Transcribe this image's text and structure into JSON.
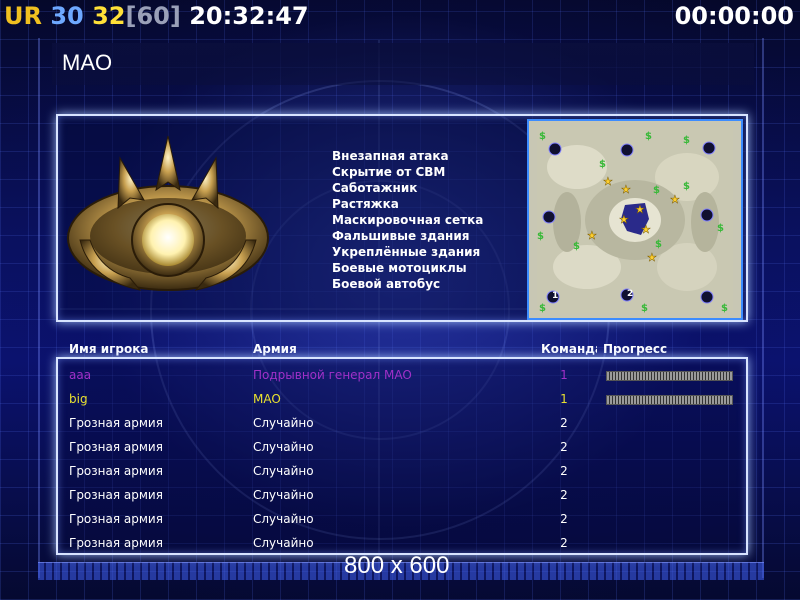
{
  "hud": {
    "ur": "UR",
    "ur_value": "30",
    "fps": "32",
    "fps_limit": "[60]",
    "clock": "20:32:47",
    "timer": "00:00:00"
  },
  "title": "MAO",
  "features": [
    "Внезапная атака",
    "Скрытие от СВМ",
    "Саботажник",
    "Растяжка",
    "Маскировочная сетка",
    "Фальшивые здания",
    "Укреплённые здания",
    "Боевые мотоциклы",
    "Боевой автобус"
  ],
  "minimap": {
    "player_markers": [
      "1",
      "2"
    ]
  },
  "table": {
    "headers": {
      "name": "Имя игрока",
      "army": "Армия",
      "team": "Команда",
      "progress": "Прогресс"
    },
    "rows": [
      {
        "name": "aaa",
        "army": "Подрывной генерал MAO",
        "team": "1",
        "color": "#a030c8",
        "progress": true
      },
      {
        "name": "big",
        "army": "MAO",
        "team": "1",
        "color": "#e8e030",
        "progress": true
      },
      {
        "name": "Грозная армия",
        "army": "Случайно",
        "team": "2",
        "color": "#ffffff",
        "progress": false
      },
      {
        "name": "Грозная армия",
        "army": "Случайно",
        "team": "2",
        "color": "#ffffff",
        "progress": false
      },
      {
        "name": "Грозная армия",
        "army": "Случайно",
        "team": "2",
        "color": "#ffffff",
        "progress": false
      },
      {
        "name": "Грозная армия",
        "army": "Случайно",
        "team": "2",
        "color": "#ffffff",
        "progress": false
      },
      {
        "name": "Грозная армия",
        "army": "Случайно",
        "team": "2",
        "color": "#ffffff",
        "progress": false
      },
      {
        "name": "Грозная армия",
        "army": "Случайно",
        "team": "2",
        "color": "#ffffff",
        "progress": false
      }
    ]
  },
  "watermark": "800 x 600"
}
